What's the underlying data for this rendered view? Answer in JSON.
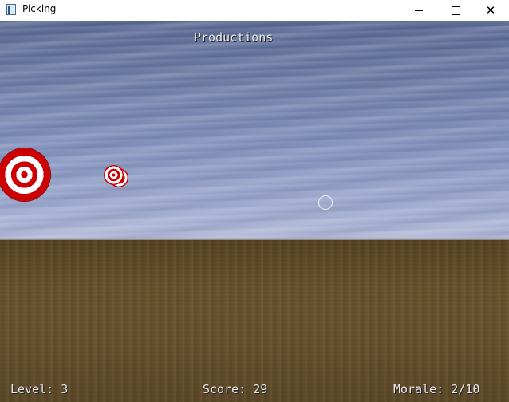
{
  "window": {
    "title": "Picking",
    "minimize_label": "",
    "maximize_label": "",
    "close_label": "✕"
  },
  "hud": {
    "title": "Productions",
    "level": "Level: 3",
    "score": "Score: 29",
    "morale": "Morale: 2/10"
  },
  "scene": {
    "sky_color": "#7c8cb8",
    "ground_color": "#6a5431",
    "target_colors": [
      "#cc0000",
      "#ffffff"
    ]
  }
}
